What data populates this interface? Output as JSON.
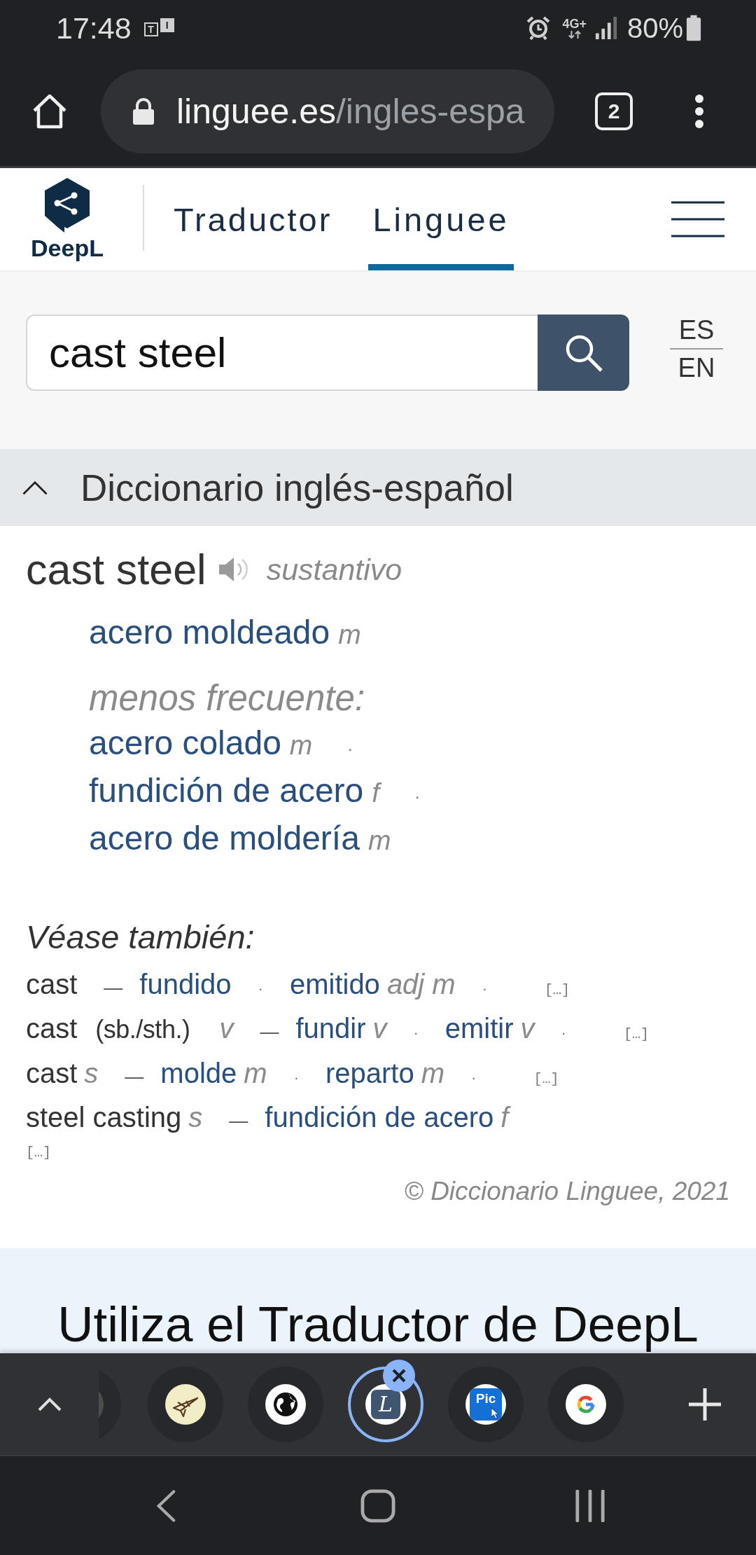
{
  "status_bar": {
    "time": "17:48",
    "notification": [
      "T",
      "I"
    ],
    "network": "4G+",
    "battery": "80%"
  },
  "browser": {
    "url_host": "linguee.es",
    "url_path": "/ingles-espa",
    "tab_count": "2"
  },
  "header": {
    "logo": "DeepL",
    "nav": [
      {
        "label": "Traductor",
        "selected": false
      },
      {
        "label": "Linguee",
        "selected": true
      }
    ]
  },
  "search": {
    "value": "cast steel",
    "languages": [
      "ES",
      "EN"
    ]
  },
  "dictionary": {
    "title": "Diccionario inglés-español",
    "expanded": true,
    "entry": {
      "headword": "cast steel",
      "pos": "sustantivo",
      "translations": [
        {
          "text": "acero moldeado",
          "gender": "m"
        }
      ],
      "less_frequent_label": "menos frecuente:",
      "less_frequent": [
        {
          "text": "acero colado",
          "gender": "m",
          "mark": "·"
        },
        {
          "text": "fundición de acero",
          "gender": "f",
          "mark": "·"
        },
        {
          "text": "acero de moldería",
          "gender": "m"
        }
      ]
    },
    "see_also": {
      "title": "Véase también:",
      "dash": "—",
      "rows": [
        {
          "term": "cast",
          "translations": [
            {
              "text": "fundido",
              "mark": "·"
            },
            {
              "text": "emitido",
              "pos": "adj m",
              "mark": "·"
            }
          ],
          "more": "[…]"
        },
        {
          "term": "cast",
          "qualifier": "(sb./sth.)",
          "pos": "v",
          "translations": [
            {
              "text": "fundir",
              "pos": "v",
              "mark": "·"
            },
            {
              "text": "emitir",
              "pos": "v",
              "mark": "·"
            }
          ],
          "more": "[…]"
        },
        {
          "term": "cast",
          "pos": "s",
          "translations": [
            {
              "text": "molde",
              "pos": "m",
              "mark": "·"
            },
            {
              "text": "reparto",
              "pos": "m",
              "mark": "·"
            }
          ],
          "more": "[…]"
        },
        {
          "term": "steel casting",
          "pos": "s",
          "translations": [
            {
              "text": "fundición de acero",
              "pos": "f"
            }
          ],
          "more_line": "[…]"
        }
      ]
    },
    "copyright": "© Diccionario Linguee, 2021"
  },
  "promo": {
    "title": "Utiliza el Traductor de DeepL"
  },
  "tab_strip": {
    "tabs": [
      {
        "kind": "partial",
        "selected": false
      },
      {
        "kind": "plane",
        "selected": false
      },
      {
        "kind": "globe",
        "selected": false
      },
      {
        "kind": "letter",
        "letter": "L",
        "selected": true
      },
      {
        "kind": "pic",
        "letter": "Pic",
        "selected": false
      },
      {
        "kind": "google",
        "selected": false
      }
    ]
  }
}
